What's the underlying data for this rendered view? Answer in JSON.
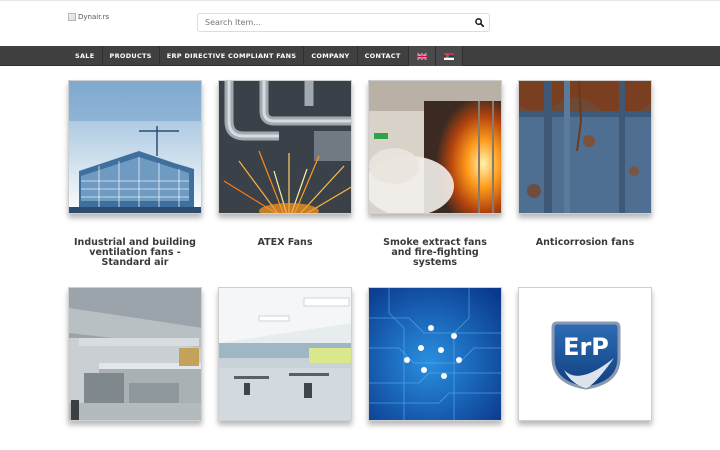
{
  "header": {
    "logo_alt": "Dynair.rs",
    "search": {
      "placeholder": "Search Item..."
    }
  },
  "nav": {
    "items": [
      "SALE",
      "PRODUCTS",
      "ERP DIRECTIVE COMPLIANT FANS",
      "COMPANY",
      "CONTACT"
    ],
    "languages": [
      "English",
      "Serbian"
    ]
  },
  "categories": [
    {
      "title": "Industrial and building ventilation fans - Standard air",
      "image": "construction-site"
    },
    {
      "title": "ATEX Fans",
      "image": "industrial-pipes-sparks"
    },
    {
      "title": "Smoke extract fans and fire-fighting systems",
      "image": "fire-smoke"
    },
    {
      "title": "Anticorrosion fans",
      "image": "rusted-metal"
    },
    {
      "title": "",
      "image": "industrial-kitchen"
    },
    {
      "title": "",
      "image": "office-interior"
    },
    {
      "title": "",
      "image": "digital-circuit"
    },
    {
      "title": "",
      "image": "erp-logo",
      "logo_text": "ErP"
    }
  ],
  "colors": {
    "nav_bg": "#404040",
    "nav_text": "#ffffff",
    "accent_blue": "#1f5fa8"
  }
}
